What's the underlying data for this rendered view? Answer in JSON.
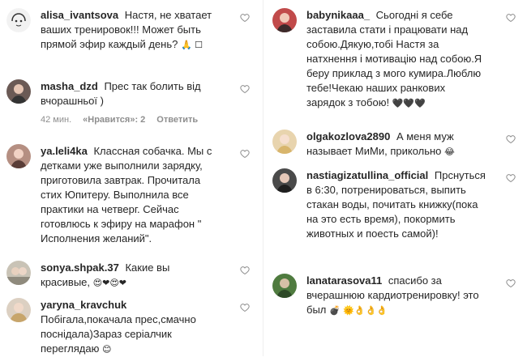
{
  "left_comments": [
    {
      "user": "alisa_ivantsova",
      "text": "Настя, не хватает ваших тренировок!!! Может быть прямой эфир каждый день?",
      "emoji": "🙏 ☐"
    },
    {
      "user": "masha_dzd",
      "text": "Прес так болить від вчорашньої )",
      "emoji": ""
    },
    {
      "user": "ya.leli4ka",
      "text": "Классная собачка. Мы с детками уже выполнили зарядку, приготовила завтрак. Прочитала стих Юпитеру. Выполнила все практики на четверг. Сейчас готовлюсь к эфиру на марафон \" Исполнения желаний\".",
      "emoji": ""
    },
    {
      "user": "sonya.shpak.37",
      "text": "Какие вы красивые,",
      "emoji": "😍❤😍❤"
    },
    {
      "user": "yaryna_kravchuk",
      "text": "Побігала,покачала прес,смачно поснідала)Зараз серіалчик переглядаю",
      "emoji": "😊"
    }
  ],
  "left_meta": {
    "time": "42 мин.",
    "likes": "«Нравится»: 2",
    "reply": "Ответить"
  },
  "right_comments": [
    {
      "user": "babynikaaa_",
      "text": "Сьогодні я себе заставила стати і працювати над собою.Дякую,тобі Настя за натхнення і мотивацію над собою.Я беру приклад з мого кумира.Люблю тебе!Чекаю наших ранкових зарядок з тобою!",
      "emoji": "🖤🖤🖤"
    },
    {
      "user": "olgakozlova2890",
      "text": "А меня муж называет МиМи, прикольно",
      "emoji": "😂"
    },
    {
      "user": "nastiagizatullina_official",
      "text": "Прснуться в 6:30, потренироваться, выпить стакан воды, почитать книжку(пока на это есть время), покормить животных и поесть самой)!",
      "emoji": ""
    },
    {
      "user": "lanatarasova11",
      "text": "спасибо за вчерашнюю кардиотренировку! это был",
      "emoji": "💣 🌞👌👌👌"
    }
  ],
  "colors": {
    "text": "#262626",
    "muted": "#8e8e8e",
    "heart": "#8e8e8e"
  }
}
